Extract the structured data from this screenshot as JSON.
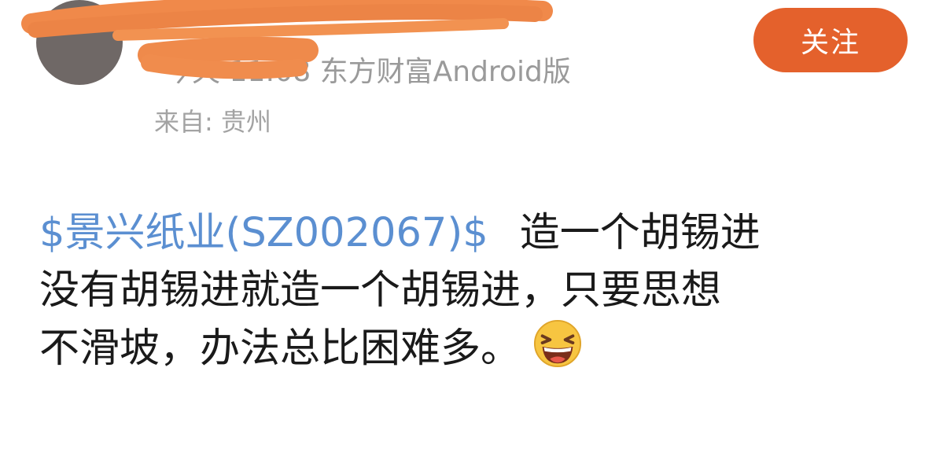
{
  "header": {
    "meta_text": "今天 11:08 东方财富Android版",
    "location_text": "来自: 贵州",
    "follow_label": "关注"
  },
  "post": {
    "stock_link": "$景兴纸业(SZ002067)$",
    "line1_text": "造一个胡锡进",
    "line2_text": "没有胡锡进就造一个胡锡进，只要思想",
    "line3_text": "不滑坡，办法总比困难多。"
  },
  "colors": {
    "accent": "#e4612c",
    "link": "#5b8fd1",
    "text": "#1a1a1a",
    "muted": "#9a9a9a"
  },
  "icons": {
    "emoji": "laughing-face-icon"
  }
}
